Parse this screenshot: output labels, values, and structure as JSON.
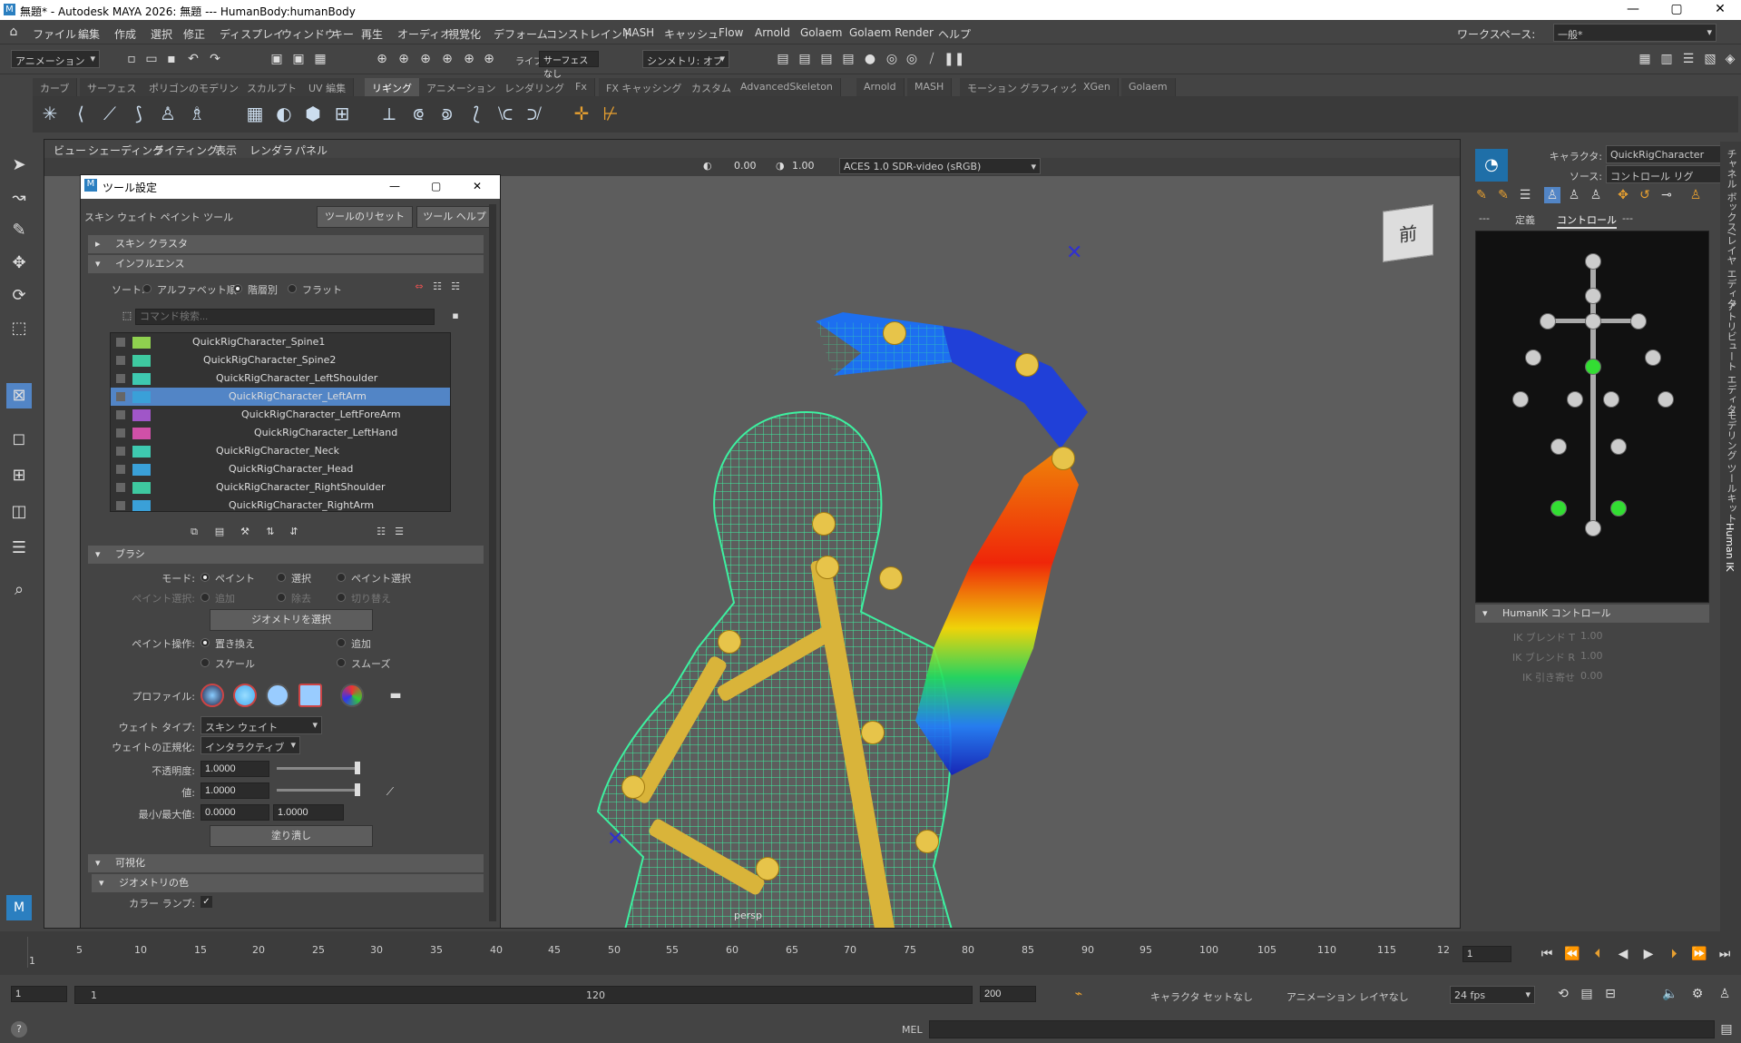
{
  "window": {
    "title": "無題* - Autodesk MAYA 2026: 無題   ---   HumanBody:humanBody",
    "minimize": "—",
    "maximize": "▢",
    "close": "✕"
  },
  "menu": [
    "ファイル",
    "編集",
    "作成",
    "選択",
    "修正",
    "ディスプレイ",
    "ウィンドウ",
    "キー",
    "再生",
    "オーディオ",
    "視覚化",
    "デフォーム",
    "コンストレイント",
    "MASH",
    "キャッシュ",
    "Flow",
    "Arnold",
    "Golaem",
    "Golaem Render",
    "ヘルプ"
  ],
  "workspace": {
    "label": "ワークスペース:",
    "value": "一般*"
  },
  "toolrow": {
    "mode": "アニメーション",
    "live": "ライブ",
    "live_surface": "サーフェスなし",
    "symmetry": "シンメトリ: オフ"
  },
  "shelf_tabs": [
    "カーブ",
    "サーフェス",
    "ポリゴンのモデリング",
    "スカルプト",
    "UV 編集",
    "リギング",
    "アニメーション",
    "レンダリング",
    "Fx",
    "FX キャッシング",
    "カスタム",
    "AdvancedSkeleton",
    "Arnold",
    "MASH",
    "モーション グラフィックス",
    "XGen",
    "Golaem"
  ],
  "shelf_active": "リギング",
  "viewport": {
    "menu": [
      "ビュー",
      "シェーディング",
      "ライティング",
      "表示",
      "レンダラ",
      "パネル"
    ],
    "exposure": "0.00",
    "gamma": "1.00",
    "colorspace": "ACES 1.0 SDR-video (sRGB)",
    "camera": "persp",
    "cube_face": "前"
  },
  "tool_settings": {
    "title": "ツール設定",
    "tool_name": "スキン ウェイト ペイント ツール",
    "reset": "ツールのリセット",
    "help": "ツール ヘルプ",
    "sections": {
      "skin_cluster": "スキン クラスタ",
      "influence": "インフルエンス",
      "brush": "ブラシ",
      "display": "可視化",
      "geo_color": "ジオメトリの色"
    },
    "sort_label": "ソート:",
    "sort_options": [
      "アルファベット順",
      "階層別",
      "フラット"
    ],
    "search_placeholder": "コマンド検索...",
    "joints": [
      {
        "name": "QuickRigCharacter_Spine1",
        "color": "#8fd14f"
      },
      {
        "name": "QuickRigCharacter_Spine2",
        "color": "#3ec9a0"
      },
      {
        "name": "QuickRigCharacter_LeftShoulder",
        "color": "#3ec9b0"
      },
      {
        "name": "QuickRigCharacter_LeftArm",
        "color": "#3aa0d8"
      },
      {
        "name": "QuickRigCharacter_LeftForeArm",
        "color": "#a056c8"
      },
      {
        "name": "QuickRigCharacter_LeftHand",
        "color": "#d050a8"
      },
      {
        "name": "QuickRigCharacter_Neck",
        "color": "#3ec9b0"
      },
      {
        "name": "QuickRigCharacter_Head",
        "color": "#3aa0d8"
      },
      {
        "name": "QuickRigCharacter_RightShoulder",
        "color": "#3ec9a0"
      },
      {
        "name": "QuickRigCharacter_RightArm",
        "color": "#3aa0d8"
      }
    ],
    "mode_label": "モード:",
    "mode_options": [
      "ペイント",
      "選択",
      "ペイント選択"
    ],
    "paint_select_label": "ペイント選択:",
    "paint_select_options": [
      "追加",
      "除去",
      "切り替え"
    ],
    "select_geo": "ジオメトリを選択",
    "paint_op_label": "ペイント操作:",
    "paint_ops": [
      "置き換え",
      "追加",
      "スケール",
      "スムーズ"
    ],
    "profile_label": "プロファイル:",
    "weight_type_label": "ウェイト タイプ:",
    "weight_type": "スキン ウェイト",
    "normalize_label": "ウェイトの正規化:",
    "normalize": "インタラクティブ",
    "opacity_label": "不透明度:",
    "opacity": "1.0000",
    "value_label": "値:",
    "value": "1.0000",
    "minmax_label": "最小/最大値:",
    "min": "0.0000",
    "max": "1.0000",
    "flood": "塗り潰し",
    "color_ramp_label": "カラー ランプ:"
  },
  "humanik": {
    "character_label": "キャラクタ:",
    "character": "QuickRigCharacter",
    "source_label": "ソース:",
    "source": "コントロール リグ",
    "tabs": [
      "---",
      "定義",
      "コントロール",
      "---"
    ],
    "controls_title": "HumanIK コントロール",
    "blend_t": "IK ブレンド T",
    "blend_t_val": "1.00",
    "blend_r": "IK ブレンド R",
    "blend_r_val": "1.00",
    "pull": "IK 引き寄せ",
    "pull_val": "0.00"
  },
  "side_tabs": [
    "チャネル ボックス/レイヤ エディタ",
    "アトリビュート エディタ",
    "モデリング ツールキット",
    "Human IK"
  ],
  "timeline": {
    "ticks": [
      "5",
      "10",
      "15",
      "20",
      "25",
      "30",
      "35",
      "40",
      "45",
      "50",
      "55",
      "60",
      "65",
      "70",
      "75",
      "80",
      "85",
      "90",
      "95",
      "100",
      "105",
      "110",
      "115",
      "12"
    ],
    "current_start": "1",
    "current_frame": "1"
  },
  "range": {
    "start": "1",
    "inner_start": "1",
    "inner_end": "120",
    "end": "200",
    "char_set": "キャラクタ セットなし",
    "anim_layer": "アニメーション レイヤなし",
    "fps": "24 fps"
  },
  "cmd": {
    "lang": "MEL",
    "help": "?"
  }
}
